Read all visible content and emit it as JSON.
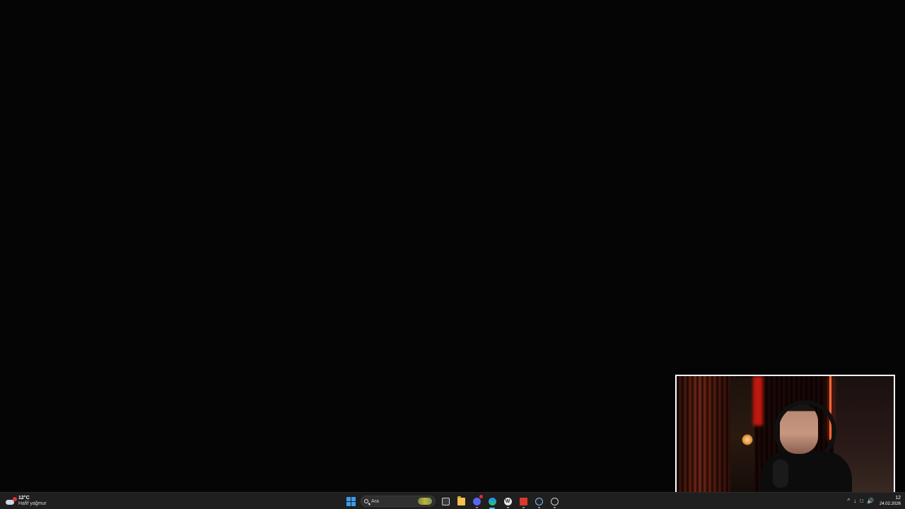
{
  "weather": {
    "temp": "12°C",
    "desc": "Hafif yağmur",
    "icon": "cloud-rain-icon"
  },
  "search": {
    "placeholder": "Ara"
  },
  "taskbar_apps": [
    {
      "name": "task-view",
      "icon": "task-view-icon"
    },
    {
      "name": "file-explorer",
      "icon": "folder-icon"
    },
    {
      "name": "discord",
      "icon": "discord-icon"
    },
    {
      "name": "edge",
      "icon": "edge-icon",
      "active": true
    },
    {
      "name": "app",
      "icon": "app-circle-icon",
      "glyph": "W"
    },
    {
      "name": "red-app",
      "icon": "red-app-icon"
    },
    {
      "name": "steam",
      "icon": "steam-icon"
    },
    {
      "name": "extra",
      "icon": "circle-icon"
    }
  ],
  "tray": {
    "chevron": "^",
    "icons": [
      "network-icon",
      "display-icon",
      "volume-icon"
    ]
  },
  "clock": {
    "time": "12",
    "date": "24.02.2026"
  },
  "colors": {
    "taskbar": "#1f1f1f",
    "accent": "#4cc2ff",
    "webcam_border": "#ffffff"
  }
}
